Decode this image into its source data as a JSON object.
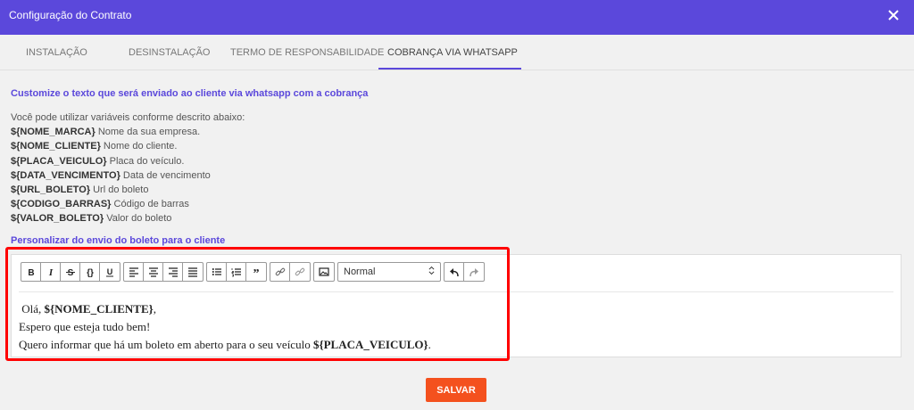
{
  "window": {
    "title": "Configuração do Contrato"
  },
  "tabs": [
    {
      "label": "INSTALAÇÃO"
    },
    {
      "label": "DESINSTALAÇÃO"
    },
    {
      "label": "TERMO DE RESPONSABILIDADE"
    },
    {
      "label": "COBRANÇA VIA WHATSAPP"
    }
  ],
  "active_tab": "COBRANÇA VIA WHATSAPP",
  "accent_color": "#5b48db",
  "save_color": "#f4511e",
  "highlight_color": "#ff0000",
  "section_title": "Customize o texto que será enviado ao cliente via whatsapp com a cobrança",
  "intro": "Você pode utilizar variáveis conforme descrito abaixo:",
  "variables": [
    {
      "name": "${NOME_MARCA}",
      "desc": "Nome da sua empresa."
    },
    {
      "name": "${NOME_CLIENTE}",
      "desc": "Nome do cliente."
    },
    {
      "name": "${PLACA_VEICULO}",
      "desc": "Placa do veículo."
    },
    {
      "name": "${DATA_VENCIMENTO}",
      "desc": "Data de vencimento"
    },
    {
      "name": "${URL_BOLETO}",
      "desc": "Url do boleto"
    },
    {
      "name": "${CODIGO_BARRAS}",
      "desc": "Código de barras"
    },
    {
      "name": "${VALOR_BOLETO}",
      "desc": "Valor do boleto"
    }
  ],
  "personalize_title": "Personalizar do envio do boleto para o cliente",
  "toolbar": {
    "format_select": "Normal",
    "icons": [
      "bold-icon",
      "italic-icon",
      "strike-icon",
      "code-icon",
      "underline-icon",
      "align-left-icon",
      "align-center-icon",
      "align-right-icon",
      "align-justify-icon",
      "bullet-list-icon",
      "ordered-list-icon",
      "blockquote-icon",
      "link-icon",
      "unlink-icon",
      "image-icon",
      "undo-icon",
      "redo-icon"
    ]
  },
  "editor": {
    "line1_pre": "Olá, ",
    "line1_var": "${NOME_CLIENTE}",
    "line1_post": ",",
    "line2": "Espero que esteja tudo bem!",
    "line3_pre": "Quero informar que há um boleto em aberto para o seu veículo ",
    "line3_var": "${PLACA_VEICULO}",
    "line3_post": "."
  },
  "save_label": "SALVAR"
}
